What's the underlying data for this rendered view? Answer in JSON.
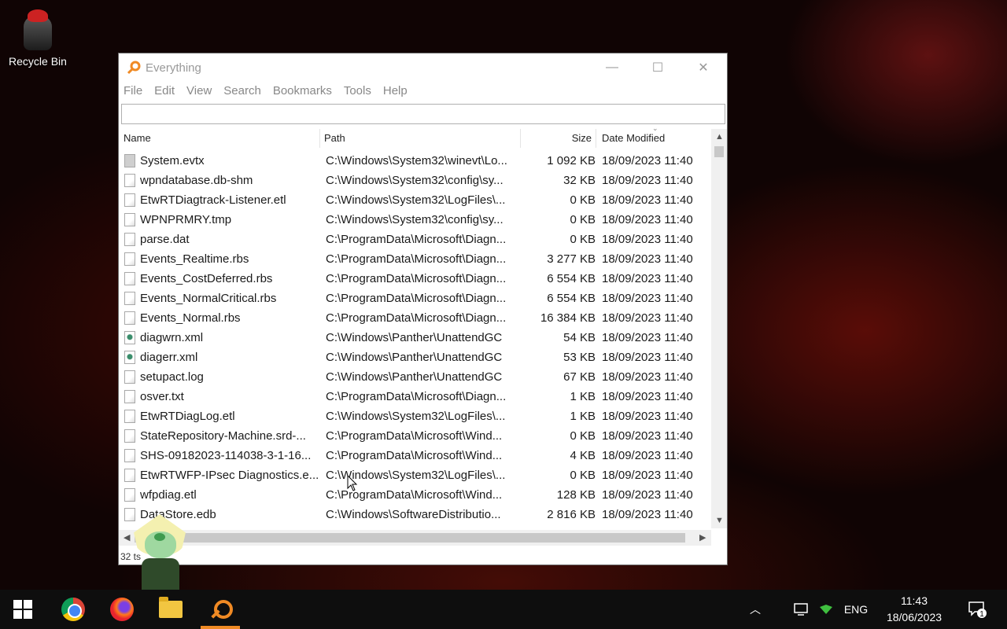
{
  "desktop": {
    "recycle_bin_label": "Recycle Bin"
  },
  "window": {
    "title": "Everything",
    "controls": {
      "minimize": "—",
      "maximize": "☐",
      "close": "✕"
    },
    "menu": [
      "File",
      "Edit",
      "View",
      "Search",
      "Bookmarks",
      "Tools",
      "Help"
    ],
    "search_value": "",
    "columns": {
      "name": "Name",
      "path": "Path",
      "size": "Size",
      "date": "Date Modified"
    },
    "rows": [
      {
        "name": "System.evtx",
        "path": "C:\\Windows\\System32\\winevt\\Lo...",
        "size": "1 092 KB",
        "date": "18/09/2023 11:40",
        "icon": "evtx"
      },
      {
        "name": "wpndatabase.db-shm",
        "path": "C:\\Windows\\System32\\config\\sy...",
        "size": "32 KB",
        "date": "18/09/2023 11:40",
        "icon": "file"
      },
      {
        "name": "EtwRTDiagtrack-Listener.etl",
        "path": "C:\\Windows\\System32\\LogFiles\\...",
        "size": "0 KB",
        "date": "18/09/2023 11:40",
        "icon": "file"
      },
      {
        "name": "WPNPRMRY.tmp",
        "path": "C:\\Windows\\System32\\config\\sy...",
        "size": "0 KB",
        "date": "18/09/2023 11:40",
        "icon": "file"
      },
      {
        "name": "parse.dat",
        "path": "C:\\ProgramData\\Microsoft\\Diagn...",
        "size": "0 KB",
        "date": "18/09/2023 11:40",
        "icon": "file"
      },
      {
        "name": "Events_Realtime.rbs",
        "path": "C:\\ProgramData\\Microsoft\\Diagn...",
        "size": "3 277 KB",
        "date": "18/09/2023 11:40",
        "icon": "file"
      },
      {
        "name": "Events_CostDeferred.rbs",
        "path": "C:\\ProgramData\\Microsoft\\Diagn...",
        "size": "6 554 KB",
        "date": "18/09/2023 11:40",
        "icon": "file"
      },
      {
        "name": "Events_NormalCritical.rbs",
        "path": "C:\\ProgramData\\Microsoft\\Diagn...",
        "size": "6 554 KB",
        "date": "18/09/2023 11:40",
        "icon": "file"
      },
      {
        "name": "Events_Normal.rbs",
        "path": "C:\\ProgramData\\Microsoft\\Diagn...",
        "size": "16 384 KB",
        "date": "18/09/2023 11:40",
        "icon": "file"
      },
      {
        "name": "diagwrn.xml",
        "path": "C:\\Windows\\Panther\\UnattendGC",
        "size": "54 KB",
        "date": "18/09/2023 11:40",
        "icon": "xml"
      },
      {
        "name": "diagerr.xml",
        "path": "C:\\Windows\\Panther\\UnattendGC",
        "size": "53 KB",
        "date": "18/09/2023 11:40",
        "icon": "xml"
      },
      {
        "name": "setupact.log",
        "path": "C:\\Windows\\Panther\\UnattendGC",
        "size": "67 KB",
        "date": "18/09/2023 11:40",
        "icon": "file"
      },
      {
        "name": "osver.txt",
        "path": "C:\\ProgramData\\Microsoft\\Diagn...",
        "size": "1 KB",
        "date": "18/09/2023 11:40",
        "icon": "file"
      },
      {
        "name": "EtwRTDiagLog.etl",
        "path": "C:\\Windows\\System32\\LogFiles\\...",
        "size": "1 KB",
        "date": "18/09/2023 11:40",
        "icon": "file"
      },
      {
        "name": "StateRepository-Machine.srd-...",
        "path": "C:\\ProgramData\\Microsoft\\Wind...",
        "size": "0 KB",
        "date": "18/09/2023 11:40",
        "icon": "file"
      },
      {
        "name": "SHS-09182023-114038-3-1-16...",
        "path": "C:\\ProgramData\\Microsoft\\Wind...",
        "size": "4 KB",
        "date": "18/09/2023 11:40",
        "icon": "file"
      },
      {
        "name": "EtwRTWFP-IPsec Diagnostics.e...",
        "path": "C:\\Windows\\System32\\LogFiles\\...",
        "size": "0 KB",
        "date": "18/09/2023 11:40",
        "icon": "file"
      },
      {
        "name": "wfpdiag.etl",
        "path": "C:\\ProgramData\\Microsoft\\Wind...",
        "size": "128 KB",
        "date": "18/09/2023 11:40",
        "icon": "file"
      },
      {
        "name": "DataStore.edb",
        "path": "C:\\Windows\\SoftwareDistributio...",
        "size": "2 816 KB",
        "date": "18/09/2023 11:40",
        "icon": "file"
      }
    ],
    "status": "32  ts"
  },
  "taskbar": {
    "tray_language": "ENG",
    "clock_time": "11:43",
    "clock_date": "18/06/2023",
    "notification_count": "1",
    "tray_up_arrow": "︿"
  }
}
